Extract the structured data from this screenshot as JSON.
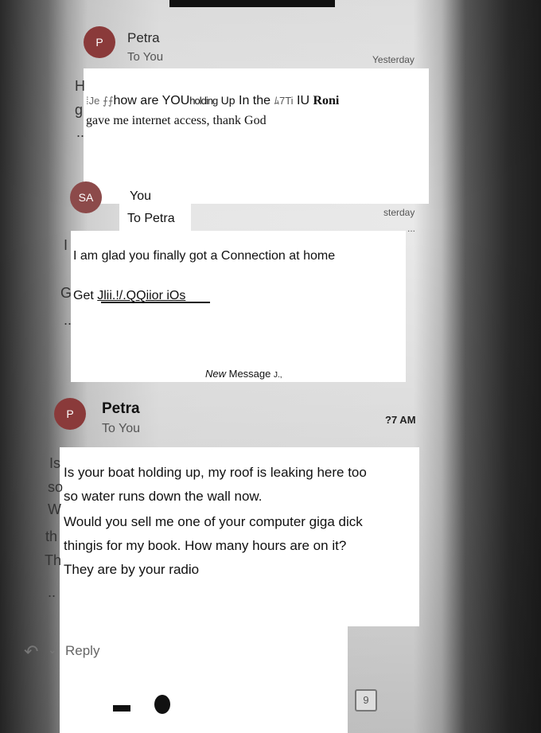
{
  "thread": [
    {
      "avatar": "P",
      "avatar_color": "#8a3a3a",
      "from": "Petra",
      "to": "To You",
      "time": "Yesterday",
      "body_parts": [
        "⁞Je ⨍⨍",
        "how are YOU",
        "holding",
        "Up",
        "In the ",
        "ﾑ7Ti",
        " IU ",
        "Roni"
      ],
      "body_line2": "gave me internet access, thank God"
    },
    {
      "avatar": "SA",
      "avatar_color": "#8c4a4a",
      "from": "You",
      "to": "To Petra",
      "time": "sterday",
      "more": "...",
      "body": "I am glad you finally got a Connection at home",
      "link_prefix": "Get ",
      "link": "Jlii.!/.QQiior iOs"
    },
    {
      "avatar": "P",
      "avatar_color": "#8a3a3a",
      "from": "Petra",
      "to": "To You",
      "time": "?7 AM",
      "lines": [
        "Is your boat holding up, my roof is leaking here too",
        "so water runs down the wall now.",
        "Would you sell me one of your computer giga dick",
        "thingis for my book. How many hours are on it?",
        "They are by your radio"
      ]
    }
  ],
  "new_message": {
    "italic": "New",
    "rest": " Message ",
    "mark": "J.,"
  },
  "reply_label": "Reply",
  "calendar_day": "9",
  "fragments": [
    "H",
    "g",
    "..",
    "I",
    "G",
    "..",
    "Is",
    "so",
    "W",
    "th",
    "Th",
    ".."
  ]
}
